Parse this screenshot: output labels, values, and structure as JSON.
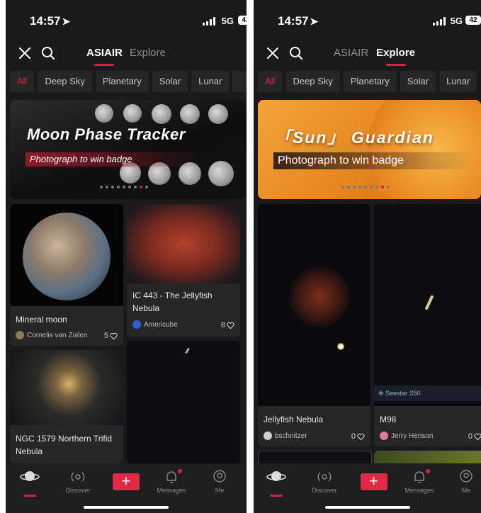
{
  "status_bar": {
    "time": "14:57",
    "network": "5G",
    "battery": "42"
  },
  "top_tabs": [
    "ASIAIR",
    "Explore"
  ],
  "categories": [
    "All",
    "Deep Sky",
    "Planetary",
    "Solar",
    "Lunar"
  ],
  "left_screen": {
    "active_tab": "ASIAIR",
    "banner": {
      "title": "Moon Phase Tracker",
      "subtitle": "Photograph to win badge"
    },
    "posts": [
      {
        "title": "Mineral moon",
        "author": "Cornelis van Zuilen",
        "likes": "5"
      },
      {
        "title": "IC 443 - The Jellyfish Nebula",
        "author": "Americube",
        "likes": "8"
      },
      {
        "title": "NGC 1579 Northern Trifid Nebula",
        "author": "",
        "likes": ""
      }
    ]
  },
  "right_screen": {
    "active_tab": "Explore",
    "banner": {
      "title": "「Sun」 Guardian",
      "subtitle": "Photograph to win badge"
    },
    "posts": [
      {
        "title": "Jellyfish Nebula",
        "author": "bschnitzer",
        "likes": "0"
      },
      {
        "title": "M98",
        "author": "Jerry Henson",
        "likes": "0"
      }
    ],
    "image_caption": "Seestar S50"
  },
  "bottom_nav": {
    "discover": "Discover",
    "messages": "Messages",
    "me": "Me"
  },
  "colors": {
    "accent": "#e0203a",
    "background": "#1a1a1b",
    "card": "#262627"
  }
}
